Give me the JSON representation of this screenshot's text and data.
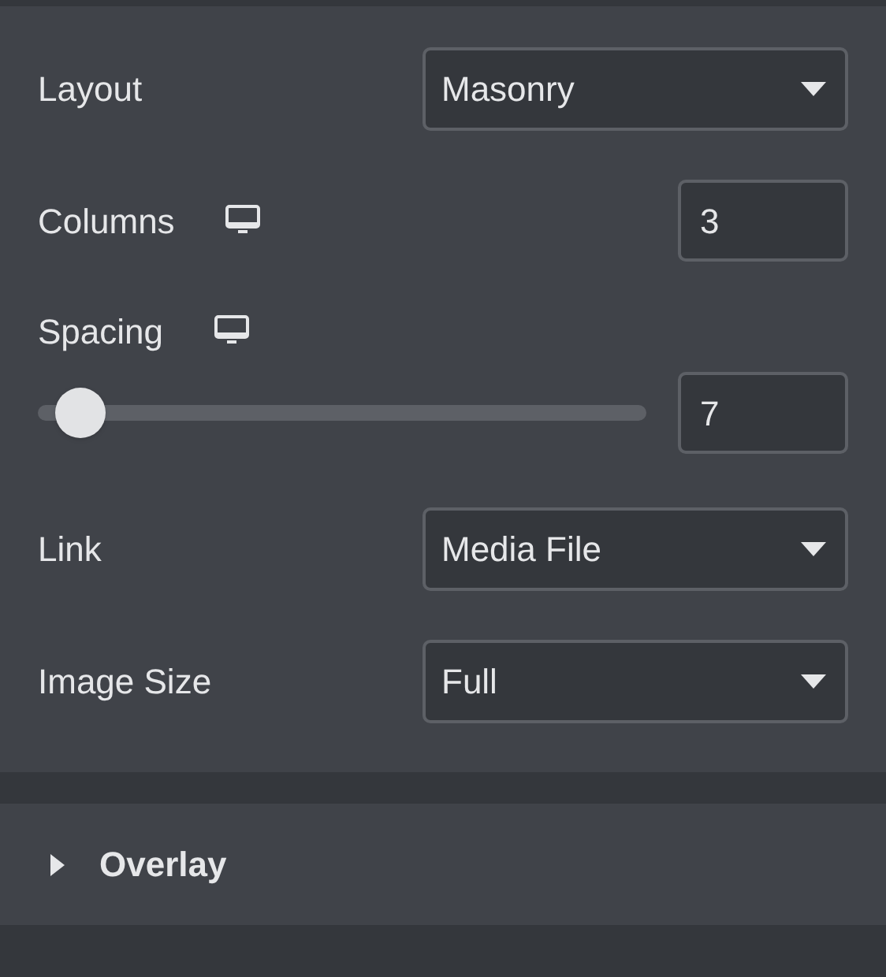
{
  "controls": [
    {
      "kind": "select",
      "label": "Layout",
      "value": "Masonry"
    },
    {
      "kind": "number",
      "label": "Columns",
      "responsive": true,
      "value": "3"
    },
    {
      "kind": "slider",
      "label": "Spacing",
      "responsive": true,
      "level": 0.07,
      "value": "7"
    },
    {
      "kind": "select",
      "label": "Link",
      "value": "Media File"
    },
    {
      "kind": "select",
      "label": "Image Size",
      "value": "Full"
    }
  ],
  "section": {
    "title": "Overlay",
    "expanded": false
  }
}
